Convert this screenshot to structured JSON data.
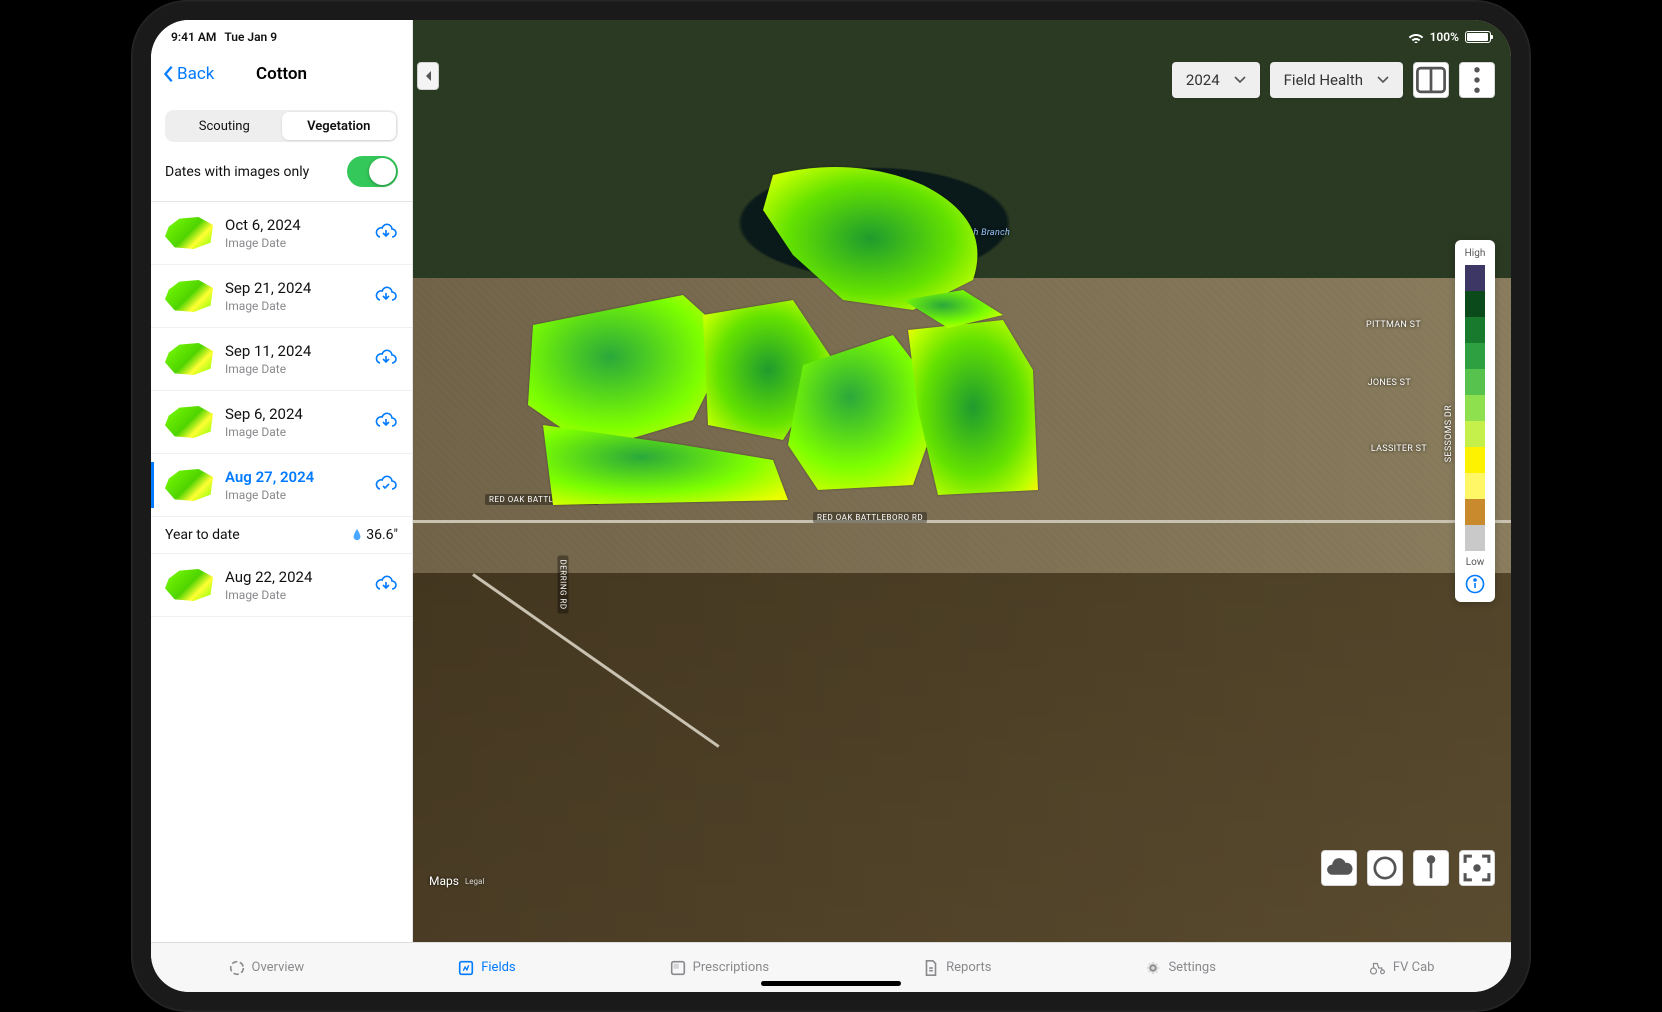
{
  "status": {
    "time": "9:41 AM",
    "date": "Tue Jan 9",
    "wifi_pct": "100%"
  },
  "sidebar": {
    "back_label": "Back",
    "title": "Cotton",
    "tabs": {
      "scouting": "Scouting",
      "vegetation": "Vegetation"
    },
    "toggle_label": "Dates with images only",
    "image_date_sub": "Image Date",
    "items": [
      {
        "date": "Oct 6, 2024"
      },
      {
        "date": "Sep 21, 2024"
      },
      {
        "date": "Sep 11, 2024"
      },
      {
        "date": "Sep 6, 2024"
      },
      {
        "date": "Aug 27, 2024",
        "selected": true
      },
      {
        "date": "Aug 22, 2024"
      }
    ],
    "ytd_label": "Year to date",
    "ytd_value": "36.6\""
  },
  "map": {
    "year_dropdown": "2024",
    "layer_dropdown": "Field Health",
    "legend_high": "High",
    "legend_low": "Low",
    "legend_colors": [
      "#3d3766",
      "#0a4a1b",
      "#177a2d",
      "#2fa042",
      "#58c24e",
      "#8fe04e",
      "#c5ef4b",
      "#fff200",
      "#fff766",
      "#c88a2c",
      "#c9c9c9"
    ],
    "roads": {
      "battleboro": "RED OAK BATTLEBORO RD",
      "derring": "DERRING RD",
      "beech": "Beech Branch",
      "pittman": "PITTMAN ST",
      "jones": "JONES ST",
      "lassiter": "LASSITER ST",
      "sessoms": "SESSOMS DR"
    },
    "maps_attr": "Maps",
    "maps_legal": "Legal"
  },
  "tabs": {
    "overview": "Overview",
    "fields": "Fields",
    "prescriptions": "Prescriptions",
    "reports": "Reports",
    "settings": "Settings",
    "fvcab": "FV Cab"
  }
}
